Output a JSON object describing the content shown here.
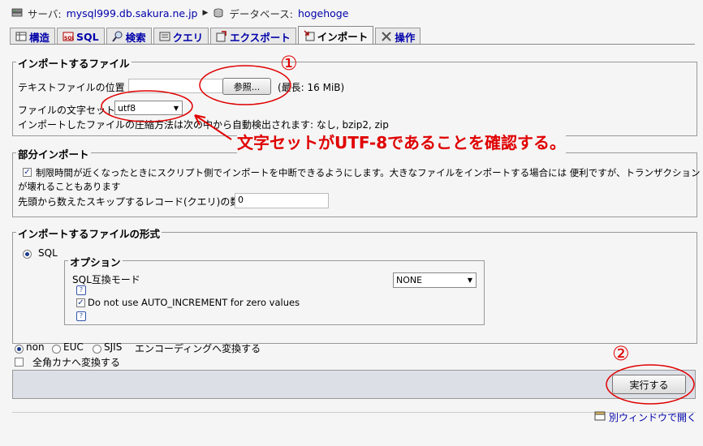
{
  "breadcrumb": {
    "server_label": "サーバ:",
    "server_value": "mysql999.db.sakura.ne.jp",
    "db_label": "データベース:",
    "db_value": "hogehoge"
  },
  "tabs": [
    {
      "label": "構造"
    },
    {
      "label": "SQL"
    },
    {
      "label": "検索"
    },
    {
      "label": "クエリ"
    },
    {
      "label": "エクスポート"
    },
    {
      "label": "インポート"
    },
    {
      "label": "操作"
    }
  ],
  "import_file": {
    "legend": "インポートするファイル",
    "file_label": "テキストファイルの位置",
    "browse_label": "参照...",
    "max_size": "(最長: 16 MiB)",
    "charset_label": "ファイルの文字セット:",
    "charset_value": "utf8",
    "compression_note": "インポートしたファイルの圧縮方法は次の中から自動検出されます: なし, bzip2, zip"
  },
  "partial_import": {
    "legend": "部分インポート",
    "interrupt_text_line1": "制限時間が近くなったときにスクリプト側でインポートを中断できるようにします。大きなファイルをインポートする場合には 便利ですが、トランザクション",
    "interrupt_text_line2": "が壊れることもあります",
    "skip_label": "先頭から数えたスキップするレコード(クエリ)の数",
    "skip_value": "0"
  },
  "format": {
    "legend": "インポートするファイルの形式",
    "sql_label": "SQL",
    "options_legend": "オプション",
    "compat_label": "SQL互換モード",
    "compat_value": "NONE",
    "auto_inc_label": "Do not use AUTO_INCREMENT for zero values"
  },
  "encoding": {
    "non": "non",
    "euc": "EUC",
    "sjis": "SJIS",
    "convert_label": "エンコーディングへ変換する",
    "kana_label": "全角カナへ変換する"
  },
  "execute_label": "実行する",
  "new_window_label": "別ウィンドウで開く",
  "annotations": {
    "circle1": "①",
    "circle2": "②",
    "note": "文字セットがUTF-8であることを確認する。",
    "color": "#e00000"
  }
}
